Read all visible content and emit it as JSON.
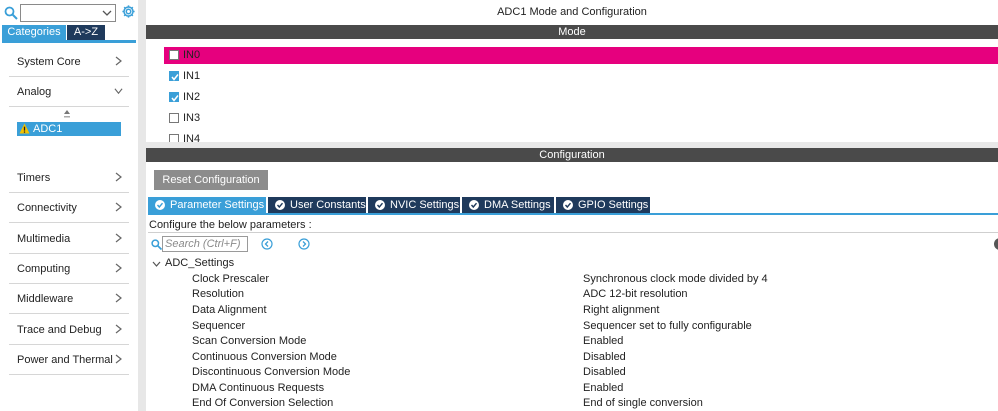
{
  "left_panel": {
    "tabs": {
      "categories": "Categories",
      "az": "A->Z"
    },
    "categories": [
      {
        "label": "System Core",
        "expanded": false
      },
      {
        "label": "Analog",
        "expanded": true
      },
      {
        "label": "Timers",
        "expanded": false
      },
      {
        "label": "Connectivity",
        "expanded": false
      },
      {
        "label": "Multimedia",
        "expanded": false
      },
      {
        "label": "Computing",
        "expanded": false
      },
      {
        "label": "Middleware",
        "expanded": false
      },
      {
        "label": "Trace and Debug",
        "expanded": false
      },
      {
        "label": "Power and Thermal",
        "expanded": false
      }
    ],
    "selected_peripheral": "ADC1",
    "icons": [
      "search-icon",
      "gear-icon",
      "chevron-right-icon",
      "chevron-down-icon",
      "warning-icon"
    ]
  },
  "main": {
    "title": "ADC1 Mode and Configuration",
    "mode_header": "Mode",
    "channels": [
      {
        "name": "IN0",
        "checked": false,
        "selected": true
      },
      {
        "name": "IN1",
        "checked": true,
        "selected": false
      },
      {
        "name": "IN2",
        "checked": true,
        "selected": false
      },
      {
        "name": "IN3",
        "checked": false,
        "selected": false
      },
      {
        "name": "IN4",
        "checked": false,
        "selected": false
      }
    ],
    "config_header": "Configuration",
    "reset_button": "Reset Configuration",
    "tabs": [
      {
        "label": "Parameter Settings",
        "active": true
      },
      {
        "label": "User Constants",
        "active": false
      },
      {
        "label": "NVIC Settings",
        "active": false
      },
      {
        "label": "DMA Settings",
        "active": false
      },
      {
        "label": "GPIO Settings",
        "active": false
      }
    ],
    "configure_text": "Configure the below parameters :",
    "search_placeholder": "Search (Ctrl+F)",
    "group": "ADC_Settings",
    "parameters": [
      {
        "name": "Clock Prescaler",
        "value": "Synchronous clock mode divided by 4"
      },
      {
        "name": "Resolution",
        "value": "ADC 12-bit resolution"
      },
      {
        "name": "Data Alignment",
        "value": "Right alignment"
      },
      {
        "name": "Sequencer",
        "value": "Sequencer set to fully configurable"
      },
      {
        "name": "Scan Conversion Mode",
        "value": "Enabled"
      },
      {
        "name": "Continuous Conversion Mode",
        "value": "Disabled"
      },
      {
        "name": "Discontinuous Conversion Mode",
        "value": "Disabled"
      },
      {
        "name": "DMA Continuous Requests",
        "value": "Enabled"
      },
      {
        "name": "End Of Conversion Selection",
        "value": "End of single conversion"
      }
    ]
  },
  "colors": {
    "accent": "#3a9fd8",
    "tab_dark": "#1f3a5c",
    "selected_channel": "#e6007e",
    "header_bar": "#4a4a4a"
  }
}
